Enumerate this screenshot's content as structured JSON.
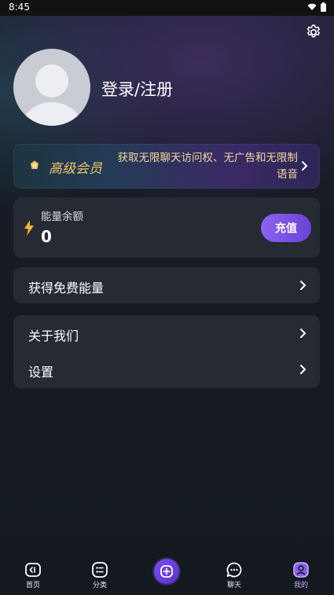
{
  "status_bar": {
    "time": "8:45"
  },
  "profile": {
    "login_text": "登录/注册"
  },
  "vip": {
    "title": "高级会员",
    "description": "获取无限聊天访问权、无广告和无限制语音"
  },
  "energy": {
    "label": "能量余额",
    "value": "0",
    "recharge_label": "充值"
  },
  "menu_free": {
    "label": "获得免费能量"
  },
  "menu_list": [
    {
      "label": "关于我们"
    },
    {
      "label": "设置"
    }
  ],
  "bottom_nav": {
    "items": [
      {
        "label": "首页",
        "icon": "home-icon"
      },
      {
        "label": "分类",
        "icon": "category-icon"
      },
      {
        "label": "",
        "icon": "create-icon"
      },
      {
        "label": "聊天",
        "icon": "chat-icon"
      },
      {
        "label": "我的",
        "icon": "profile-icon",
        "active": true
      }
    ]
  },
  "colors": {
    "accent": "#7a4cf0",
    "vip_gold": "#f1c36a",
    "card_bg": "#252a33"
  }
}
